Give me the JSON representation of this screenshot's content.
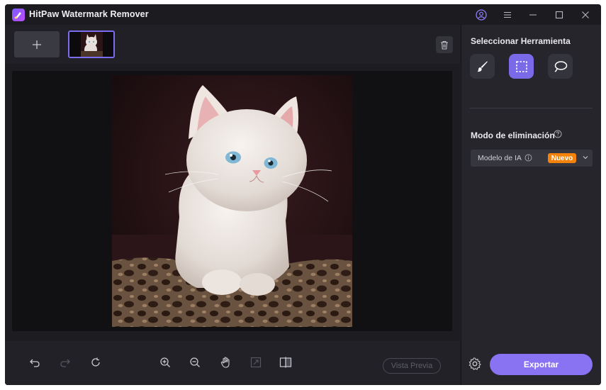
{
  "app": {
    "title": "HitPaw Watermark Remover"
  },
  "right_panel": {
    "tool_heading": "Seleccionar Herramienta",
    "tools": [
      {
        "name": "brush",
        "icon": "brush-icon",
        "active": false
      },
      {
        "name": "rectangle-select",
        "icon": "rectangle-select-icon",
        "active": true
      },
      {
        "name": "lasso",
        "icon": "lasso-icon",
        "active": false
      }
    ],
    "mode_heading": "Modo de eliminación",
    "model_select": {
      "value": "Modelo de IA",
      "badge": "Nuevo"
    },
    "export_label": "Exportar"
  },
  "bottom_toolbar": {
    "preview_label": "Vista Previa",
    "icons": [
      "undo-icon",
      "redo-icon",
      "reset-icon",
      "zoom-in-icon",
      "zoom-out-icon",
      "hand-icon",
      "fit-screen-icon",
      "compare-icon"
    ]
  },
  "colors": {
    "accent": "#7b6ae8",
    "export": "#8a73f2",
    "badge": "#f2820a"
  }
}
